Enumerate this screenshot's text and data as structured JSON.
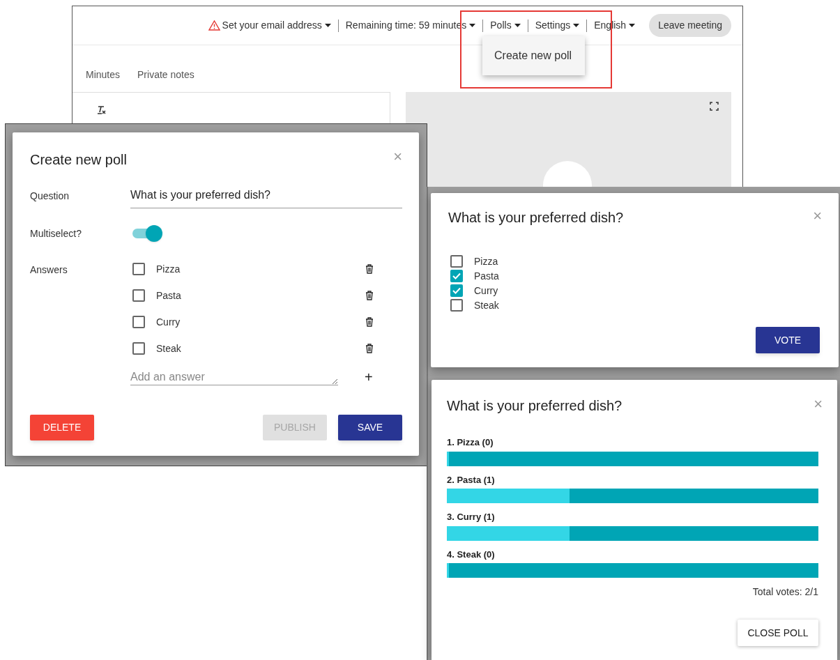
{
  "meeting": {
    "header": {
      "email_warning": "Set your email address",
      "remaining_time": "Remaining time: 59 minutes",
      "menus": [
        "Polls",
        "Settings",
        "English"
      ],
      "leave_button": "Leave meeting"
    },
    "polls_menu": {
      "items": [
        "Create new poll"
      ]
    },
    "tabs": [
      "Minutes",
      "Private notes"
    ]
  },
  "create_poll_dialog": {
    "title": "Create new poll",
    "close": "×",
    "question_label": "Question",
    "question_value": "What is your preferred dish?",
    "multiselect_label": "Multiselect?",
    "multiselect_on": true,
    "answers_label": "Answers",
    "answers": [
      {
        "label": "Pizza",
        "checked": false
      },
      {
        "label": "Pasta",
        "checked": false
      },
      {
        "label": "Curry",
        "checked": false
      },
      {
        "label": "Steak",
        "checked": false
      }
    ],
    "add_answer_placeholder": "Add an answer",
    "add_symbol": "+",
    "buttons": [
      {
        "label": "DELETE",
        "kind": "danger",
        "disabled": false
      },
      {
        "label": "PUBLISH",
        "kind": "primary",
        "disabled": true
      },
      {
        "label": "SAVE",
        "kind": "primary",
        "disabled": false
      }
    ]
  },
  "vote_dialog": {
    "title": "What is your preferred dish?",
    "close": "×",
    "options": [
      {
        "label": "Pizza",
        "checked": false
      },
      {
        "label": "Pasta",
        "checked": true
      },
      {
        "label": "Curry",
        "checked": true
      },
      {
        "label": "Steak",
        "checked": false
      }
    ],
    "button": "VOTE"
  },
  "results_dialog": {
    "title": "What is your preferred dish?",
    "close": "×",
    "results": [
      {
        "label": "1. Pizza (0)",
        "level": 0
      },
      {
        "label": "2. Pasta (1)",
        "level": 0.33
      },
      {
        "label": "3. Curry (1)",
        "level": 0.33
      },
      {
        "label": "4. Steak (0)",
        "level": 0
      }
    ],
    "total": "Total votes: 2/1",
    "button": "CLOSE POLL"
  }
}
